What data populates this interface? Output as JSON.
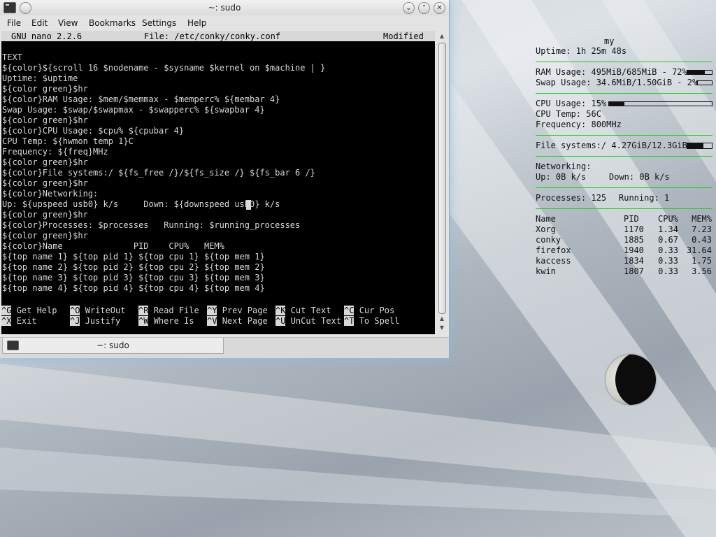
{
  "window": {
    "title": "~: sudo",
    "buttons": {
      "minimize": "⌄",
      "maximize": "⌃",
      "close": "✕"
    },
    "menu": [
      "File",
      "Edit",
      "View",
      "Bookmarks",
      "Settings",
      "Help"
    ],
    "tab_label": "~: sudo"
  },
  "nano": {
    "version": "GNU nano 2.2.6",
    "file": "File: /etc/conky/conky.conf",
    "status": "Modified",
    "lines": [
      "TEXT",
      "${color}${scroll 16 $nodename - $sysname $kernel on $machine | }",
      "Uptime: $uptime",
      "${color green}$hr",
      "${color}RAM Usage: $mem/$memmax - $memperc% ${membar 4}",
      "Swap Usage: $swap/$swapmax - $swapperc% ${swapbar 4}",
      "${color green}$hr",
      "${color}CPU Usage: $cpu% ${cpubar 4}",
      "CPU Temp: ${hwmon temp 1}C",
      "Frequency: ${freq}MHz",
      "${color green}$hr",
      "${color}File systems:/ ${fs_free /}/${fs_size /} ${fs_bar 6 /}",
      "${color green}$hr",
      "${color}Networking:",
      "Up: ${upspeed usb0} k/s     Down: ${downspeed usb0} k/s",
      "${color green}$hr",
      "${color}Processes: $processes   Running: $running_processes",
      "${color green}$hr",
      "${color}Name              PID    CPU%   MEM%",
      "${top name 1} ${top pid 1} ${top cpu 1} ${top mem 1}",
      "${top name 2} ${top pid 2} ${top cpu 2} ${top mem 2}",
      "${top name 3} ${top pid 3} ${top cpu 3} ${top mem 3}",
      "${top name 4} ${top pid 4} ${top cpu 4} ${top mem 4}"
    ],
    "shortcuts": [
      {
        "key": "^G",
        "label": "Get Help"
      },
      {
        "key": "^O",
        "label": "WriteOut"
      },
      {
        "key": "^R",
        "label": "Read File"
      },
      {
        "key": "^Y",
        "label": "Prev Page"
      },
      {
        "key": "^K",
        "label": "Cut Text"
      },
      {
        "key": "^C",
        "label": "Cur Pos"
      },
      {
        "key": "^X",
        "label": "Exit"
      },
      {
        "key": "^J",
        "label": "Justify"
      },
      {
        "key": "^W",
        "label": "Where Is"
      },
      {
        "key": "^V",
        "label": "Next Page"
      },
      {
        "key": "^U",
        "label": "UnCut Text"
      },
      {
        "key": "^T",
        "label": "To Spell"
      }
    ]
  },
  "conky": {
    "nodename": "my",
    "uptime": "Uptime: 1h 25m 48s",
    "ram": "RAM Usage: 495MiB/685MiB - 72%",
    "ram_fraction": 0.72,
    "swap": "Swap Usage: 34.6MiB/1.50GiB - 2%",
    "swap_fraction": 0.02,
    "cpu": "CPU Usage: 15%",
    "cpu_fraction": 0.15,
    "cpu_temp": "CPU Temp: 56C",
    "frequency": "Frequency: 800MHz",
    "fs": "File systems:/ 4.27GiB/12.3GiB",
    "fs_fraction": 0.65,
    "networking": "Networking:",
    "up": "Up: 0B k/s",
    "down": "Down: 0B k/s",
    "processes": "Processes: 125",
    "running": "Running: 1",
    "table_headers": [
      "Name",
      "PID",
      "CPU%",
      "MEM%"
    ],
    "rows": [
      [
        "Xorg",
        "1170",
        "1.34",
        "7.23"
      ],
      [
        "conky",
        "1885",
        "0.67",
        "0.43"
      ],
      [
        "firefox",
        "1940",
        "0.33",
        "31.64"
      ],
      [
        "kaccess",
        "1834",
        "0.33",
        "1.75"
      ],
      [
        "kwin",
        "1807",
        "0.33",
        "3.56"
      ]
    ],
    "rule_color": "#16d216"
  }
}
